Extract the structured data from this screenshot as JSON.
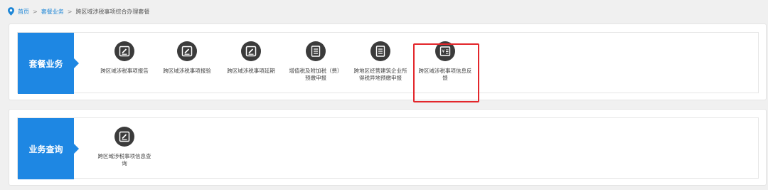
{
  "breadcrumb": {
    "home": "首页",
    "section": "套餐业务",
    "current": "跨区域涉税事项综合办理套餐",
    "separator": ">"
  },
  "panels": [
    {
      "title": "套餐业务",
      "items": [
        {
          "label": "跨区域涉税事项报告",
          "icon": "pencil-square-icon"
        },
        {
          "label": "跨区域涉税事项报验",
          "icon": "pencil-square-icon"
        },
        {
          "label": "跨区域涉税事项延期",
          "icon": "pencil-square-icon"
        },
        {
          "label": "增值税及附加税（费）预缴申报",
          "icon": "document-list-icon"
        },
        {
          "label": "跨地区经营建筑企业所得税异地预缴申报",
          "icon": "document-list-icon"
        },
        {
          "label": "跨区域涉税事项信息反馈",
          "icon": "yen-document-icon"
        }
      ]
    },
    {
      "title": "业务查询",
      "items": [
        {
          "label": "跨区域涉税事项信息查询",
          "icon": "pencil-square-icon"
        }
      ]
    }
  ],
  "colors": {
    "accent": "#1e87e3",
    "link": "#1e86d6",
    "highlight": "#e3262b",
    "icon_bg": "#3b3b3b"
  }
}
